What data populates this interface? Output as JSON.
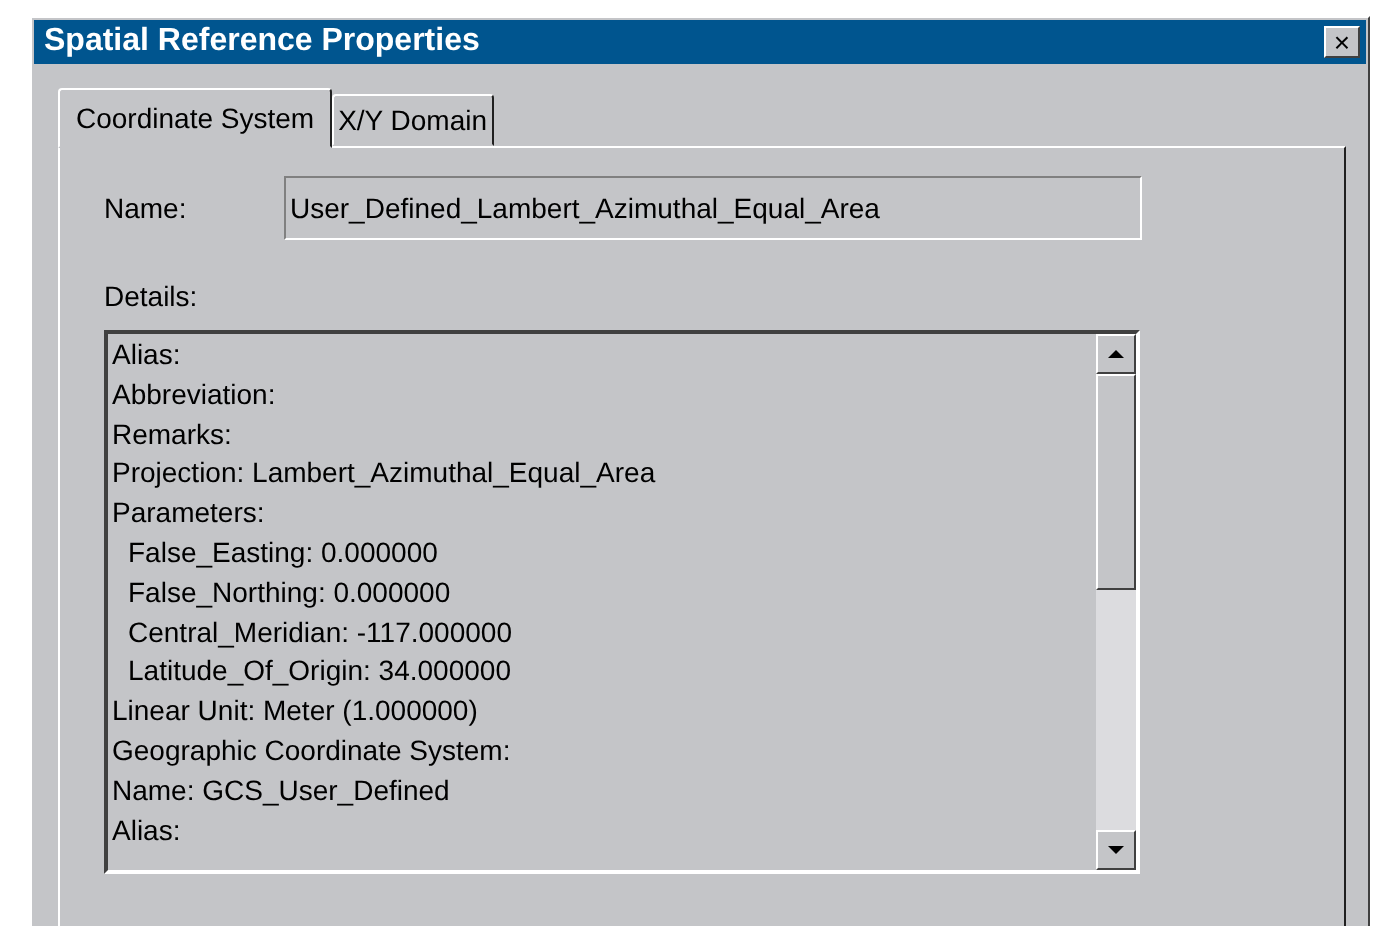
{
  "window": {
    "title": "Spatial Reference Properties",
    "close_label": "×"
  },
  "tabs": [
    {
      "label": "Coordinate System",
      "selected": true
    },
    {
      "label": "X/Y Domain",
      "selected": false
    }
  ],
  "name_field": {
    "label": "Name:",
    "value": "User_Defined_Lambert_Azimuthal_Equal_Area"
  },
  "details": {
    "label": "Details:",
    "lines": [
      {
        "text": "Alias:"
      },
      {
        "text": "Abbreviation:"
      },
      {
        "text": "Remarks:"
      },
      {
        "text": "Projection: Lambert_Azimuthal_Equal_Area"
      },
      {
        "text": "Parameters:",
        "children": [
          {
            "text": "False_Easting: 0.000000"
          },
          {
            "text": "False_Northing: 0.000000"
          },
          {
            "text": "Central_Meridian: -117.000000"
          },
          {
            "text": "Latitude_Of_Origin: 34.000000"
          }
        ]
      },
      {
        "text": "Linear Unit: Meter (1.000000)"
      },
      {
        "text": "Geographic Coordinate System:"
      },
      {
        "text": "Name: GCS_User_Defined"
      },
      {
        "text": "Alias:"
      }
    ]
  }
}
